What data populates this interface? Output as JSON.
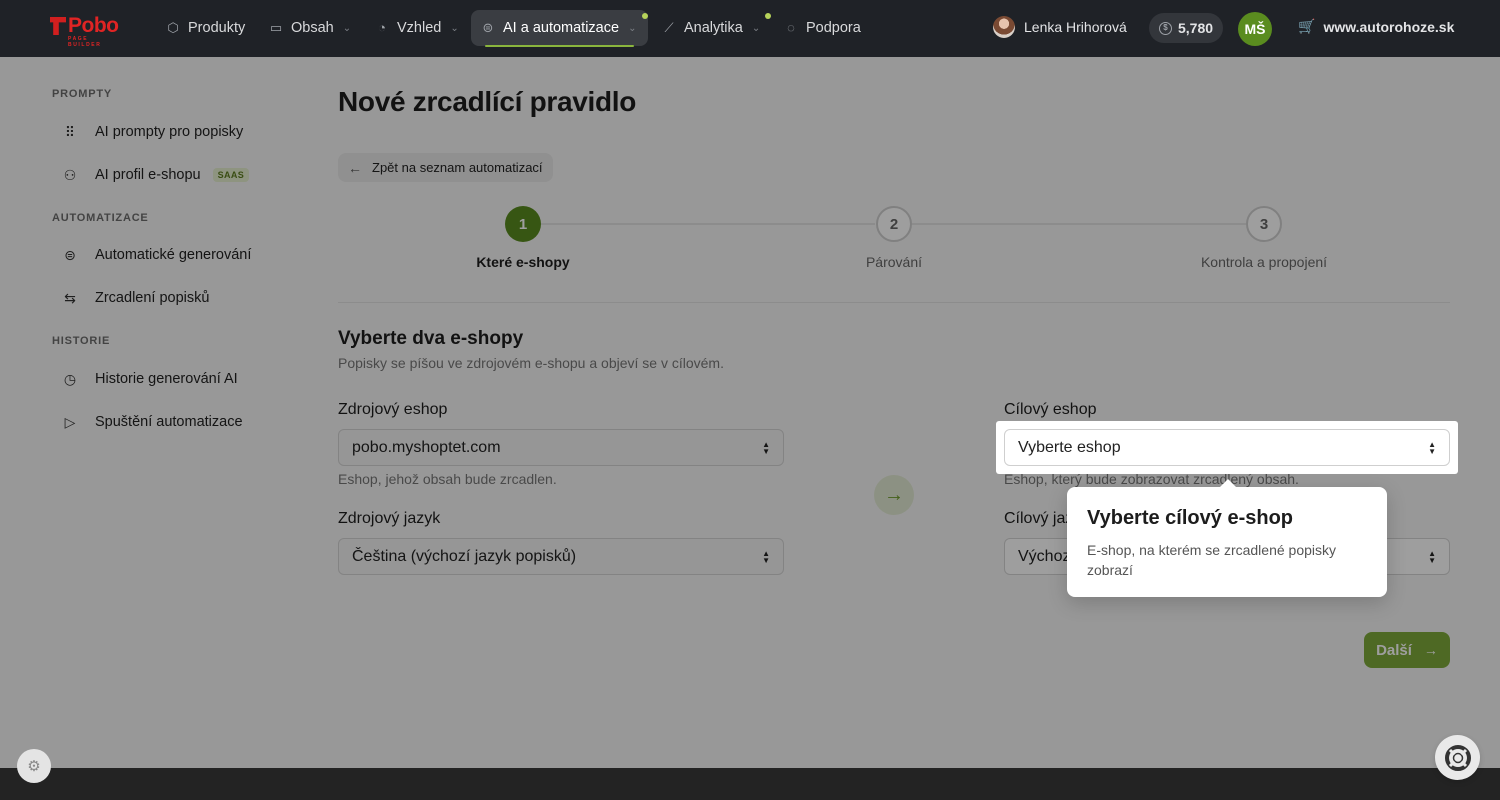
{
  "app": {
    "logo_text": "Pobo",
    "logo_sub": "PAGE BUILDER"
  },
  "nav": {
    "items": [
      {
        "label": "Produkty",
        "icon": "box-icon"
      },
      {
        "label": "Obsah",
        "icon": "folder-icon"
      },
      {
        "label": "Vzhled",
        "icon": "palette-icon"
      },
      {
        "label": "AI a automatizace",
        "icon": "robot-icon"
      },
      {
        "label": "Analytika",
        "icon": "chart-icon"
      },
      {
        "label": "Podpora",
        "icon": "chat-icon"
      }
    ],
    "user_name": "Lenka Hrihorová",
    "credits": "5,780",
    "initials": "MŠ",
    "site": "www.autorohoze.sk"
  },
  "sidebar": {
    "sections": [
      {
        "label": "PROMPTY",
        "items": [
          {
            "label": "AI prompty pro popisky",
            "icon": "grid-icon"
          },
          {
            "label": "AI profil e-shopu",
            "icon": "user-gear-icon",
            "badge": "SAAS"
          }
        ]
      },
      {
        "label": "AUTOMATIZACE",
        "items": [
          {
            "label": "Automatické generování",
            "icon": "robot-icon"
          },
          {
            "label": "Zrcadlení popisků",
            "icon": "swap-icon"
          }
        ]
      },
      {
        "label": "HISTORIE",
        "items": [
          {
            "label": "Historie generování AI",
            "icon": "clock-icon"
          },
          {
            "label": "Spuštění automatizace",
            "icon": "play-icon"
          }
        ]
      }
    ]
  },
  "page": {
    "title": "Nové zrcadlící pravidlo",
    "back_label": "Zpět na seznam automatizací",
    "steps": [
      {
        "num": "1",
        "label": "Které e-shopy"
      },
      {
        "num": "2",
        "label": "Párování"
      },
      {
        "num": "3",
        "label": "Kontrola a propojení"
      }
    ],
    "section_title": "Vyberte dva e-shopy",
    "section_sub": "Popisky se píšou ve zdrojovém e-shopu a objeví se v cílovém.",
    "source_eshop_label": "Zdrojový eshop",
    "source_eshop_value": "pobo.myshoptet.com",
    "source_eshop_help": "Eshop, jehož obsah bude zrcadlen.",
    "source_lang_label": "Zdrojový jazyk",
    "source_lang_value": "Čeština (výchozí jazyk popisků)",
    "target_eshop_label": "Cílový eshop",
    "target_eshop_value": "Vyberte eshop",
    "target_eshop_help": "Eshop, který bude zobrazovat zrcadlený obsah.",
    "target_lang_label": "Cílový jazyk",
    "target_lang_value": "Výchozí",
    "next_label": "Další"
  },
  "tooltip": {
    "title": "Vyberte cílový e-shop",
    "body": "E-shop, na kterém se zrcadlené popisky zobrazí"
  },
  "colors": {
    "accent": "#5a8c1f",
    "nav_bg": "#1f2227",
    "badge_bg": "#e5efcf"
  }
}
